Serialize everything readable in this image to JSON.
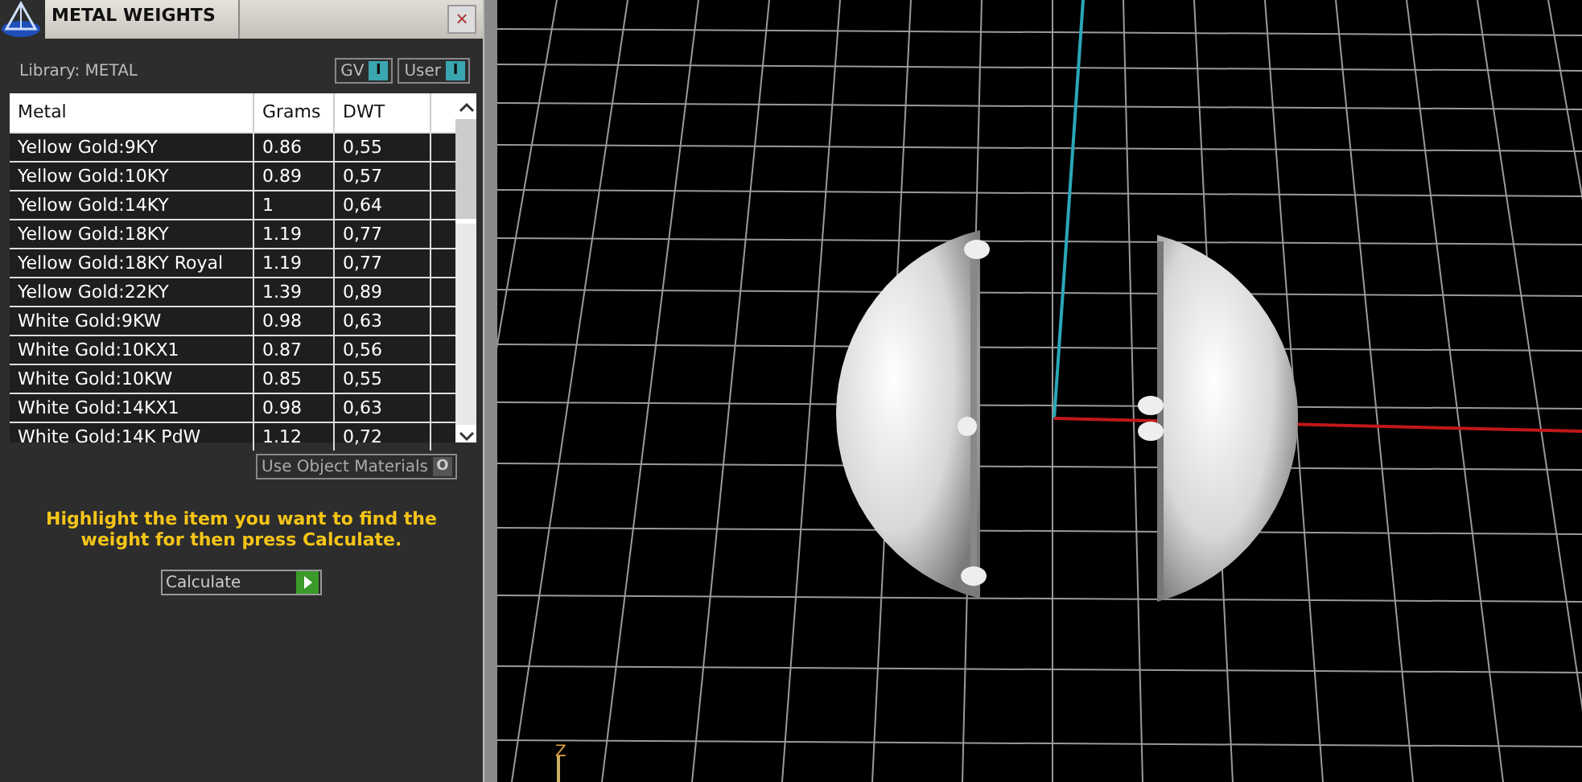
{
  "panel": {
    "title": "METAL WEIGHTS",
    "close": "×",
    "library": "Library: METAL",
    "toggles": [
      {
        "label": "GV",
        "mark": "I",
        "on": true
      },
      {
        "label": "User",
        "mark": "I",
        "on": true
      }
    ],
    "table": {
      "columns": [
        "Metal",
        "Grams",
        "DWT"
      ],
      "rows": [
        {
          "metal": "Yellow Gold:9KY",
          "grams": "0.86",
          "dwt": "0,55",
          "selected": false
        },
        {
          "metal": "Yellow Gold:10KY",
          "grams": "0.89",
          "dwt": "0,57",
          "selected": false
        },
        {
          "metal": "Yellow Gold:14KY",
          "grams": "1",
          "dwt": "0,64",
          "selected": false
        },
        {
          "metal": "Yellow Gold:18KY",
          "grams": "1.19",
          "dwt": "0,77",
          "selected": false
        },
        {
          "metal": "Yellow Gold:18KY Royal",
          "grams": "1.19",
          "dwt": "0,77",
          "selected": false
        },
        {
          "metal": "Yellow Gold:22KY",
          "grams": "1.39",
          "dwt": "0,89",
          "selected": false
        },
        {
          "metal": "White Gold:9KW",
          "grams": "0.98",
          "dwt": "0,63",
          "selected": false
        },
        {
          "metal": "White Gold:10KX1",
          "grams": "0.87",
          "dwt": "0,56",
          "selected": false
        },
        {
          "metal": "White Gold:10KW",
          "grams": "0.85",
          "dwt": "0,55",
          "selected": false
        },
        {
          "metal": "White Gold:14KX1",
          "grams": "0.98",
          "dwt": "0,63",
          "selected": false
        },
        {
          "metal": "White Gold:14K PdW",
          "grams": "1.12",
          "dwt": "0,72",
          "selected": false
        }
      ]
    },
    "use_object_materials": {
      "label": "Use Object Materials",
      "mark": "O",
      "on": false
    },
    "hint": "Highlight the item you want to find the weight for then press Calculate.",
    "calculate": "Calculate"
  },
  "viewport": {
    "axis_label": "Z"
  }
}
